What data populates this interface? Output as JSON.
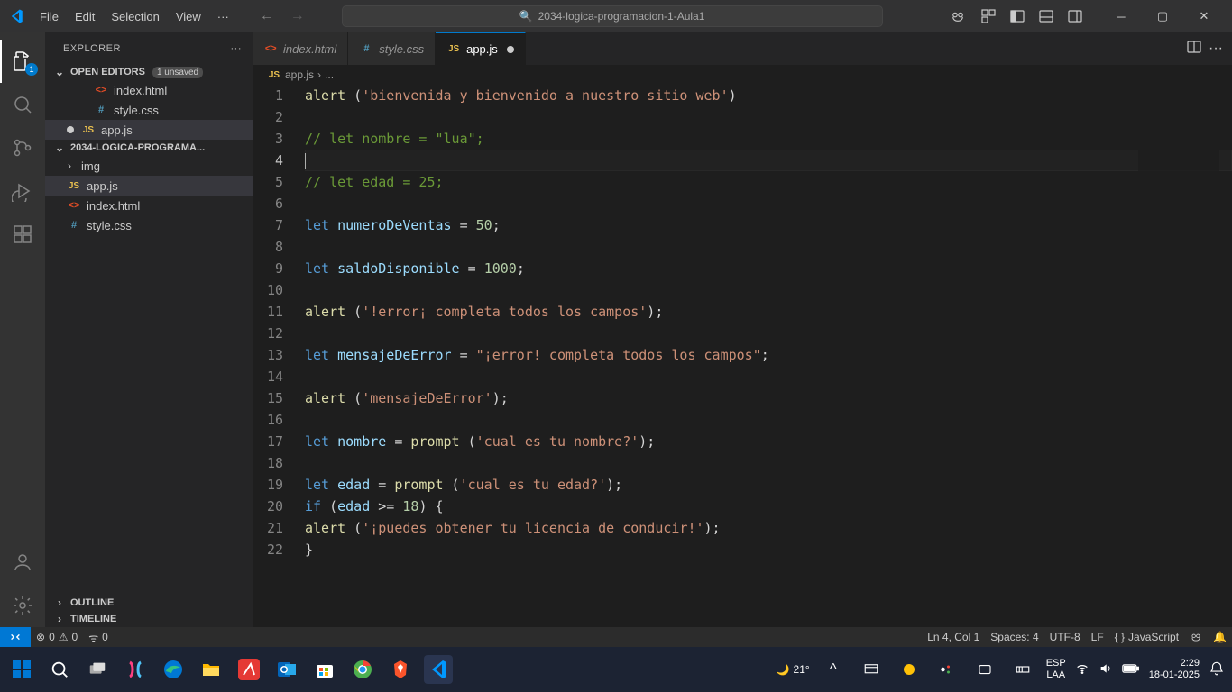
{
  "titlebar": {
    "menu": [
      "File",
      "Edit",
      "Selection",
      "View"
    ],
    "command_center": "2034-logica-programacion-1-Aula1"
  },
  "activity": {
    "explorer_badge": "1"
  },
  "sidebar": {
    "title": "EXPLORER",
    "open_editors_label": "OPEN EDITORS",
    "unsaved_label": "1 unsaved",
    "open_editors": [
      {
        "name": "index.html",
        "icon": "html",
        "unsaved": false
      },
      {
        "name": "style.css",
        "icon": "css",
        "unsaved": false
      },
      {
        "name": "app.js",
        "icon": "js",
        "unsaved": true
      }
    ],
    "project_label": "2034-LOGICA-PROGRAMA...",
    "folder_img": "img",
    "files": [
      {
        "name": "app.js",
        "icon": "js",
        "active": true
      },
      {
        "name": "index.html",
        "icon": "html",
        "active": false
      },
      {
        "name": "style.css",
        "icon": "css",
        "active": false
      }
    ],
    "outline": "OUTLINE",
    "timeline": "TIMELINE"
  },
  "tabs": [
    {
      "label": "index.html",
      "icon": "html",
      "active": false,
      "unsaved": false
    },
    {
      "label": "style.css",
      "icon": "css",
      "active": false,
      "unsaved": false
    },
    {
      "label": "app.js",
      "icon": "js",
      "active": true,
      "unsaved": true
    }
  ],
  "breadcrumb": {
    "file": "app.js",
    "more": "..."
  },
  "code": {
    "lines": [
      [
        {
          "c": "tok-fn",
          "t": "alert"
        },
        {
          "c": "tok-op",
          "t": " ("
        },
        {
          "c": "tok-str",
          "t": "'bienvenida y bienvenido a nuestro sitio web'"
        },
        {
          "c": "tok-op",
          "t": ")"
        }
      ],
      [
        {
          "c": "tok-op",
          "t": ""
        }
      ],
      [
        {
          "c": "tok-com",
          "t": "// let nombre = \"lua\";"
        }
      ],
      [
        {
          "c": "cursor",
          "t": ""
        }
      ],
      [
        {
          "c": "tok-com",
          "t": "// let edad = 25;"
        }
      ],
      [
        {
          "c": "tok-op",
          "t": ""
        }
      ],
      [
        {
          "c": "tok-kw",
          "t": "let"
        },
        {
          "c": "tok-op",
          "t": " "
        },
        {
          "c": "tok-var",
          "t": "numeroDeVentas"
        },
        {
          "c": "tok-op",
          "t": " = "
        },
        {
          "c": "tok-num",
          "t": "50"
        },
        {
          "c": "tok-op",
          "t": ";"
        }
      ],
      [
        {
          "c": "tok-op",
          "t": ""
        }
      ],
      [
        {
          "c": "tok-kw",
          "t": "let"
        },
        {
          "c": "tok-op",
          "t": " "
        },
        {
          "c": "tok-var",
          "t": "saldoDisponible"
        },
        {
          "c": "tok-op",
          "t": " = "
        },
        {
          "c": "tok-num",
          "t": "1000"
        },
        {
          "c": "tok-op",
          "t": ";"
        }
      ],
      [
        {
          "c": "tok-op",
          "t": ""
        }
      ],
      [
        {
          "c": "tok-fn",
          "t": "alert"
        },
        {
          "c": "tok-op",
          "t": " ("
        },
        {
          "c": "tok-str",
          "t": "'!error¡ completa todos los campos'"
        },
        {
          "c": "tok-op",
          "t": ");"
        }
      ],
      [
        {
          "c": "tok-op",
          "t": ""
        }
      ],
      [
        {
          "c": "tok-kw",
          "t": "let"
        },
        {
          "c": "tok-op",
          "t": " "
        },
        {
          "c": "tok-var",
          "t": "mensajeDeError"
        },
        {
          "c": "tok-op",
          "t": " = "
        },
        {
          "c": "tok-str",
          "t": "\"¡error! completa todos los campos\""
        },
        {
          "c": "tok-op",
          "t": ";"
        }
      ],
      [
        {
          "c": "tok-op",
          "t": ""
        }
      ],
      [
        {
          "c": "tok-fn",
          "t": "alert"
        },
        {
          "c": "tok-op",
          "t": " ("
        },
        {
          "c": "tok-str",
          "t": "'mensajeDeError'"
        },
        {
          "c": "tok-op",
          "t": ");"
        }
      ],
      [
        {
          "c": "tok-op",
          "t": ""
        }
      ],
      [
        {
          "c": "tok-kw",
          "t": "let"
        },
        {
          "c": "tok-op",
          "t": " "
        },
        {
          "c": "tok-var",
          "t": "nombre"
        },
        {
          "c": "tok-op",
          "t": " = "
        },
        {
          "c": "tok-fn",
          "t": "prompt"
        },
        {
          "c": "tok-op",
          "t": " ("
        },
        {
          "c": "tok-str",
          "t": "'cual es tu nombre?'"
        },
        {
          "c": "tok-op",
          "t": ");"
        }
      ],
      [
        {
          "c": "tok-op",
          "t": ""
        }
      ],
      [
        {
          "c": "tok-kw",
          "t": "let"
        },
        {
          "c": "tok-op",
          "t": " "
        },
        {
          "c": "tok-var",
          "t": "edad"
        },
        {
          "c": "tok-op",
          "t": " = "
        },
        {
          "c": "tok-fn",
          "t": "prompt"
        },
        {
          "c": "tok-op",
          "t": " ("
        },
        {
          "c": "tok-str",
          "t": "'cual es tu edad?'"
        },
        {
          "c": "tok-op",
          "t": ");"
        }
      ],
      [
        {
          "c": "tok-kw",
          "t": "if"
        },
        {
          "c": "tok-op",
          "t": " ("
        },
        {
          "c": "tok-var",
          "t": "edad"
        },
        {
          "c": "tok-op",
          "t": " >= "
        },
        {
          "c": "tok-num",
          "t": "18"
        },
        {
          "c": "tok-op",
          "t": ") {"
        }
      ],
      [
        {
          "c": "tok-fn",
          "t": "alert"
        },
        {
          "c": "tok-op",
          "t": " ("
        },
        {
          "c": "tok-str",
          "t": "'¡puedes obtener tu licencia de conducir!'"
        },
        {
          "c": "tok-op",
          "t": ");"
        }
      ],
      [
        {
          "c": "tok-op",
          "t": "}"
        }
      ]
    ],
    "current_line": 4
  },
  "status": {
    "errors": "0",
    "warnings": "0",
    "ports": "0",
    "ln_col": "Ln 4, Col 1",
    "spaces": "Spaces: 4",
    "encoding": "UTF-8",
    "eol": "LF",
    "lang": "JavaScript"
  },
  "taskbar": {
    "weather_temp": "21°",
    "lang1": "ESP",
    "lang2": "LAA",
    "time": "2:29",
    "date": "18-01-2025"
  }
}
